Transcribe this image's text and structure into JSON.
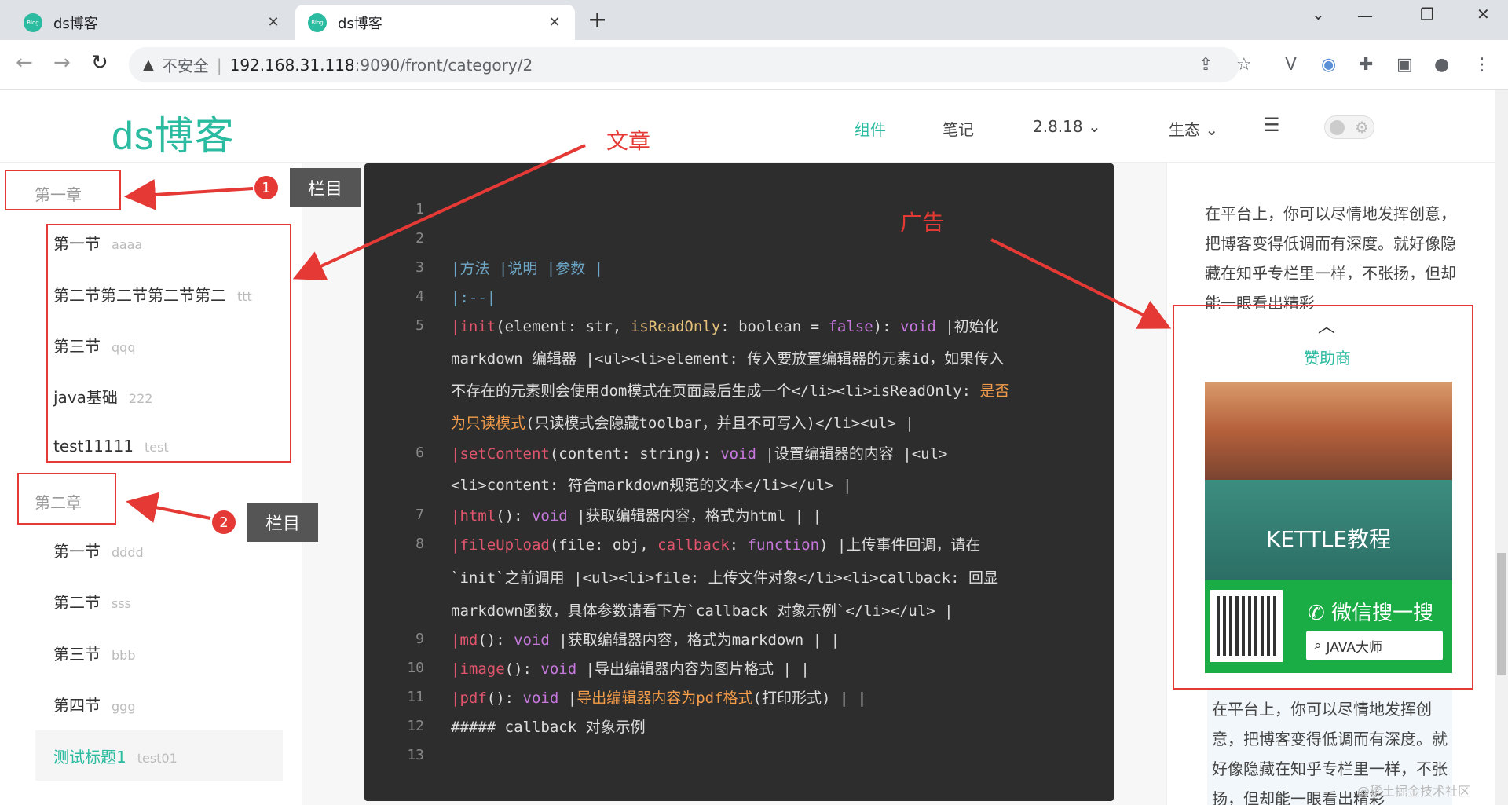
{
  "browser": {
    "tabs": [
      {
        "label": "ds博客",
        "favicon": "Blog"
      },
      {
        "label": "ds博客",
        "favicon": "Blog"
      }
    ],
    "address": {
      "insecure_label": "不安全",
      "host": "192.168.31.118",
      "path": ":9090/front/category/2"
    }
  },
  "header": {
    "logo": "ds博客",
    "nav": [
      {
        "label": "组件",
        "active": true
      },
      {
        "label": "笔记"
      },
      {
        "label": "2.8.18"
      },
      {
        "label": "生态"
      }
    ]
  },
  "sidebar": {
    "chapters": [
      {
        "title": "第一章",
        "sections": [
          {
            "label": "第一节",
            "sub": "aaaa"
          },
          {
            "label": "第二节第二节第二节第二",
            "sub": "ttt"
          },
          {
            "label": "第三节",
            "sub": "qqq"
          },
          {
            "label": "java基础",
            "sub": "222"
          },
          {
            "label": "test11111",
            "sub": "test"
          }
        ]
      },
      {
        "title": "第二章",
        "sections": [
          {
            "label": "第一节",
            "sub": "dddd"
          },
          {
            "label": "第二节",
            "sub": "sss"
          },
          {
            "label": "第三节",
            "sub": "bbb"
          },
          {
            "label": "第四节",
            "sub": "ggg"
          },
          {
            "label": "测试标题1",
            "sub": "test01",
            "current": true
          }
        ]
      }
    ]
  },
  "code": {
    "line_numbers": [
      "1",
      "2",
      "3",
      "4",
      "5",
      "6",
      "7",
      "8",
      "9",
      "10",
      "11",
      "12",
      "13"
    ],
    "lines": {
      "l3": "|方法 |说明 |参数 |",
      "l4": "|:--|",
      "l5a": "|init",
      "l5b": "(element: str, ",
      "l5c": "isReadOnly",
      "l5d": ": boolean = ",
      "l5e": "false",
      "l5f": "): ",
      "l5g": "void",
      "l5h": " |初始化",
      "l5i": "markdown 编辑器 |<ul><li>element: 传入要放置编辑器的元素id，如果传入",
      "l5j": "不存在的元素则会使用dom模式在页面最后生成一个</li><li>isReadOnly: ",
      "l5k": "是否",
      "l5l": "为只读模式",
      "l5m": "(只读模式会隐藏toolbar，并且不可写入)</li><ul> |",
      "l6a": "|setContent",
      "l6b": "(content: string): ",
      "l6c": "void",
      "l6d": " |设置编辑器的内容 |<ul>",
      "l6e": "<li>content: 符合markdown规范的文本</li></ul> |",
      "l7a": "|html",
      "l7b": "(): ",
      "l7c": "void",
      "l7d": " |获取编辑器内容，格式为html | |",
      "l8a": "|fileUpload",
      "l8b": "(file: obj, ",
      "l8c": "callback",
      "l8d": ": ",
      "l8e": "function",
      "l8f": ") |上传事件回调，请在",
      "l8g": "`init`之前调用 |<ul><li>file: 上传文件对象</li><li>callback: 回显",
      "l8h": "markdown函数，具体参数请看下方`callback 对象示例`</li></ul> |",
      "l9a": "|md",
      "l9b": "(): ",
      "l9c": "void",
      "l9d": " |获取编辑器内容，格式为markdown | |",
      "l10a": "|image",
      "l10b": "(): ",
      "l10c": "void",
      "l10d": " |导出编辑器内容为图片格式 | |",
      "l11a": "|pdf",
      "l11b": "(): ",
      "l11c": "void",
      "l11d": " |",
      "l11e": "导出编辑器内容为pdf格式",
      "l11f": "(打印形式) | |",
      "l12": "##### callback 对象示例"
    }
  },
  "right": {
    "intro": "在平台上，你可以尽情地发挥创意，把博客变得低调而有深度。就好像隐藏在知乎专栏里一样，不张扬，但却能一眼看出精彩",
    "sponsor_title": "赞助商",
    "ad_title": "KETTLE教程",
    "wechat_label": "微信搜一搜",
    "wechat_search": "JAVA大师",
    "lower": "在平台上，你可以尽情地发挥创意，把博客变得低调而有深度。就好像隐藏在知乎专栏里一样，不张扬，但却能一眼看出精彩",
    "watermark": "@稀土掘金技术社区"
  },
  "annotations": {
    "article": "文章",
    "ad": "广告",
    "badge1": "1",
    "badge2": "2",
    "tag1": "栏目",
    "tag2": "栏目"
  },
  "colors": {
    "accent": "#2bbba0",
    "annotation": "#e53935",
    "code_bg": "#2d2d2d"
  }
}
